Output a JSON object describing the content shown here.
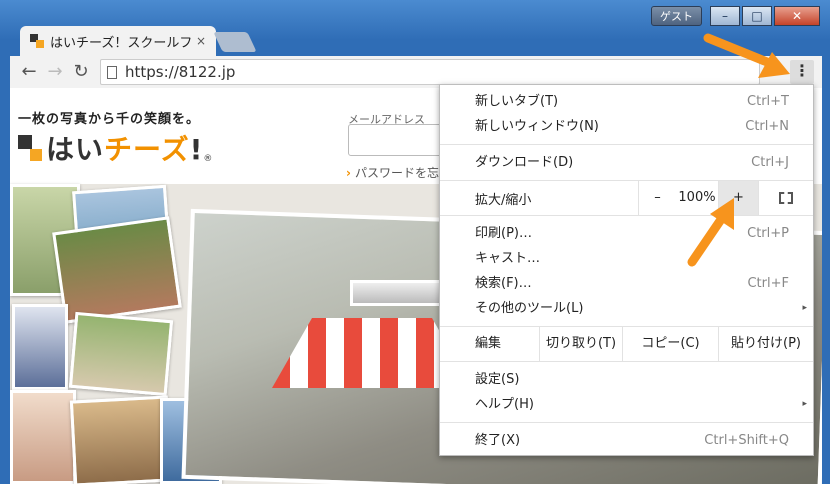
{
  "window": {
    "guest_label": "ゲスト",
    "minimize": "–",
    "maximize": "□",
    "close": "✕"
  },
  "tab": {
    "title": "はいチーズ！スクールフ",
    "close": "×"
  },
  "toolbar": {
    "back": "←",
    "forward": "→",
    "reload": "↻",
    "url": "https://8122.jp",
    "menu": "⋮"
  },
  "page": {
    "tagline": "一枚の写真から千の笑顔を。",
    "logo_pre": "はい",
    "logo_orange": "チーズ",
    "logo_post": "!",
    "logo_r": "®",
    "mail_label": "メールアドレス",
    "pw_link": "パスワードを忘"
  },
  "menu": {
    "new_tab": {
      "label": "新しいタブ(T)",
      "shortcut": "Ctrl+T"
    },
    "new_window": {
      "label": "新しいウィンドウ(N)",
      "shortcut": "Ctrl+N"
    },
    "download": {
      "label": "ダウンロード(D)",
      "shortcut": "Ctrl+J"
    },
    "zoom": {
      "label": "拡大/縮小",
      "minus": "–",
      "value": "100%",
      "plus": "+"
    },
    "print": {
      "label": "印刷(P)…",
      "shortcut": "Ctrl+P"
    },
    "cast": {
      "label": "キャスト…"
    },
    "find": {
      "label": "検索(F)…",
      "shortcut": "Ctrl+F"
    },
    "more_tools": {
      "label": "その他のツール(L)",
      "arrow": "▸"
    },
    "edit": {
      "label": "編集",
      "cut": "切り取り(T)",
      "copy": "コピー(C)",
      "paste": "貼り付け(P)"
    },
    "settings": {
      "label": "設定(S)"
    },
    "help": {
      "label": "ヘルプ(H)",
      "arrow": "▸"
    },
    "exit": {
      "label": "終了(X)",
      "shortcut": "Ctrl+Shift+Q"
    }
  },
  "colors": {
    "accent_orange": "#f29100",
    "arrow_orange": "#f7941d"
  }
}
